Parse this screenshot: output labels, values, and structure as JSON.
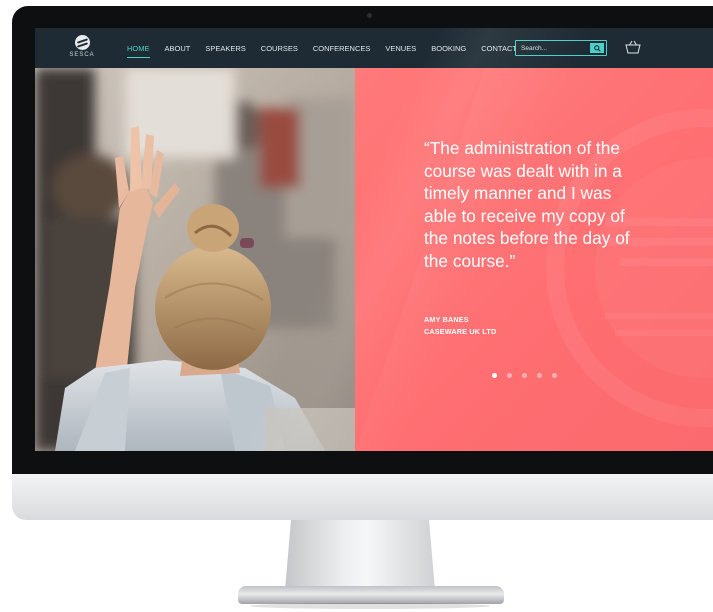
{
  "brand": {
    "name": "SESCA"
  },
  "nav": {
    "items": [
      {
        "label": "HOME",
        "active": true
      },
      {
        "label": "ABOUT",
        "active": false
      },
      {
        "label": "SPEAKERS",
        "active": false
      },
      {
        "label": "COURSES",
        "active": false
      },
      {
        "label": "CONFERENCES",
        "active": false
      },
      {
        "label": "VENUES",
        "active": false
      },
      {
        "label": "BOOKING",
        "active": false
      },
      {
        "label": "CONTACT",
        "active": false
      }
    ],
    "search_placeholder": "Search...",
    "search_icon": "search-icon",
    "basket_icon": "basket-icon"
  },
  "testimonial": {
    "quote": "“The administration of the course was dealt with in a timely manner and I was able to receive my copy of the notes before the day of the course.”",
    "author": "AMY BANES",
    "company": "CASEWARE UK LTD",
    "slide_count": 5,
    "active_slide": 1
  },
  "colors": {
    "nav_background": "#1e2b34",
    "accent": "#4dd0c7",
    "testimonial_background": "#fe6a6d",
    "text_light": "#ffffff"
  }
}
